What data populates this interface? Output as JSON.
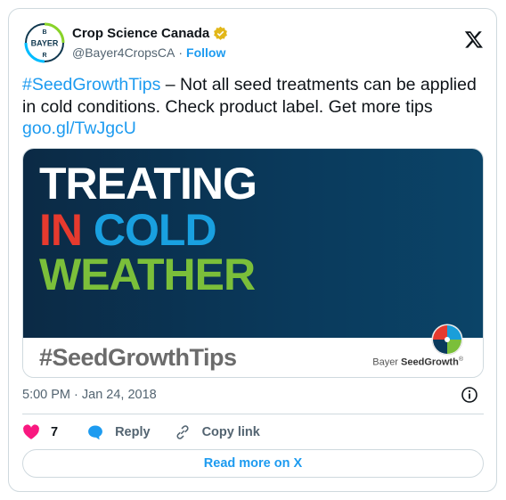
{
  "author": {
    "display_name": "Crop Science Canada",
    "handle": "@Bayer4CropsCA",
    "separator": "·",
    "follow_label": "Follow",
    "avatar_text": "BAYER"
  },
  "tweet": {
    "hashtag": "#SeedGrowthTips",
    "body": " – Not all seed treatments can be applied in cold conditions. Check product label. Get more tips ",
    "link": "goo.gl/TwJgcU"
  },
  "media": {
    "line1": "TREATING",
    "line2_a": "IN",
    "line2_b": "COLD",
    "line3": "WEATHER",
    "hashtag": "#SeedGrowthTips",
    "brand_prefix": "Bayer ",
    "brand_name": "SeedGrowth",
    "brand_mark": "®",
    "colors": {
      "in": "#e63a2e",
      "cold": "#19a0e0",
      "weather": "#7bbf3a",
      "background": "#0a3a5c"
    }
  },
  "timestamp": "5:00 PM · Jan 24, 2018",
  "actions": {
    "like_count": "7",
    "reply_label": "Reply",
    "copy_label": "Copy link"
  },
  "read_more_label": "Read more on X",
  "icons": [
    "bayer-logo-icon",
    "verified-badge-icon",
    "x-logo-icon",
    "info-icon",
    "heart-icon",
    "reply-icon",
    "link-icon"
  ]
}
